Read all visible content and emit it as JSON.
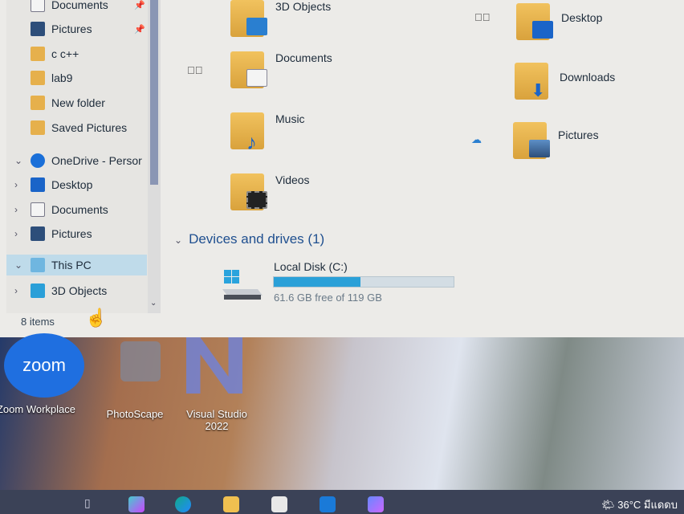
{
  "nav": {
    "items": [
      {
        "label": "Documents",
        "pinned": true,
        "icon": "documents-icon"
      },
      {
        "label": "Pictures",
        "pinned": true,
        "icon": "pictures-icon"
      },
      {
        "label": "c c++",
        "icon": "folder-icon"
      },
      {
        "label": "lab9",
        "icon": "folder-icon"
      },
      {
        "label": "New folder",
        "icon": "folder-icon"
      },
      {
        "label": "Saved Pictures",
        "icon": "folder-icon"
      },
      {
        "label": "OneDrive - Persor",
        "icon": "cloud-icon",
        "expanded": true
      },
      {
        "label": "Desktop",
        "icon": "desktop-icon"
      },
      {
        "label": "Documents",
        "icon": "documents-icon"
      },
      {
        "label": "Pictures",
        "icon": "pictures-icon"
      },
      {
        "label": "This PC",
        "icon": "computer-icon",
        "expanded": true,
        "selected": true
      },
      {
        "label": "3D Objects",
        "icon": "3d-objects-icon"
      }
    ],
    "pin_glyph": "📌"
  },
  "status": {
    "items_count": "8 items"
  },
  "folders": [
    {
      "label": "3D Objects",
      "icon": "3d-objects-folder-icon"
    },
    {
      "label": "Desktop",
      "icon": "desktop-folder-icon"
    },
    {
      "label": "Documents",
      "icon": "documents-folder-icon"
    },
    {
      "label": "Downloads",
      "icon": "downloads-folder-icon"
    },
    {
      "label": "Music",
      "icon": "music-folder-icon"
    },
    {
      "label": "Pictures",
      "icon": "pictures-folder-icon"
    },
    {
      "label": "Videos",
      "icon": "videos-folder-icon"
    }
  ],
  "devices": {
    "header": "Devices and drives (1)",
    "drive": {
      "name": "Local Disk (C:)",
      "free": "61.6 GB free of 119 GB",
      "used_fraction": 0.48
    }
  },
  "desktop": {
    "icons": [
      {
        "label": "Zoom Workplace",
        "logo": "zoom"
      },
      {
        "label": "PhotoScape"
      },
      {
        "label": "Visual Studio 2022"
      }
    ]
  },
  "taskbar": {
    "weather": "36°C",
    "tray_text": "มีแดดบ"
  },
  "colors": {
    "accent": "#2aa0d8",
    "selection": "#bfdbea"
  }
}
